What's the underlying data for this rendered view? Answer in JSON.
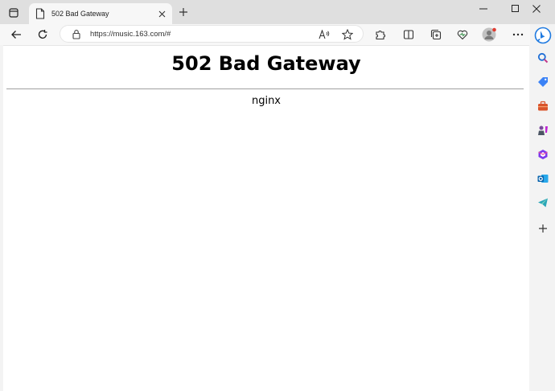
{
  "tab": {
    "title": "502 Bad Gateway"
  },
  "address_bar": {
    "url": "https://music.163.com/#"
  },
  "page": {
    "heading": "502 Bad Gateway",
    "server": "nginx"
  },
  "colors": {
    "accent": "#0078d4",
    "tab_strip": "#dfdfdf",
    "toolbar": "#f7f7f7",
    "page_bg": "#ffffff"
  },
  "icons": {
    "sidebar": [
      "bing-chat-icon",
      "search-icon",
      "shopping-tag-icon",
      "tools-icon",
      "games-icon",
      "office-icon",
      "outlook-icon",
      "telegram-icon",
      "add-icon"
    ]
  }
}
